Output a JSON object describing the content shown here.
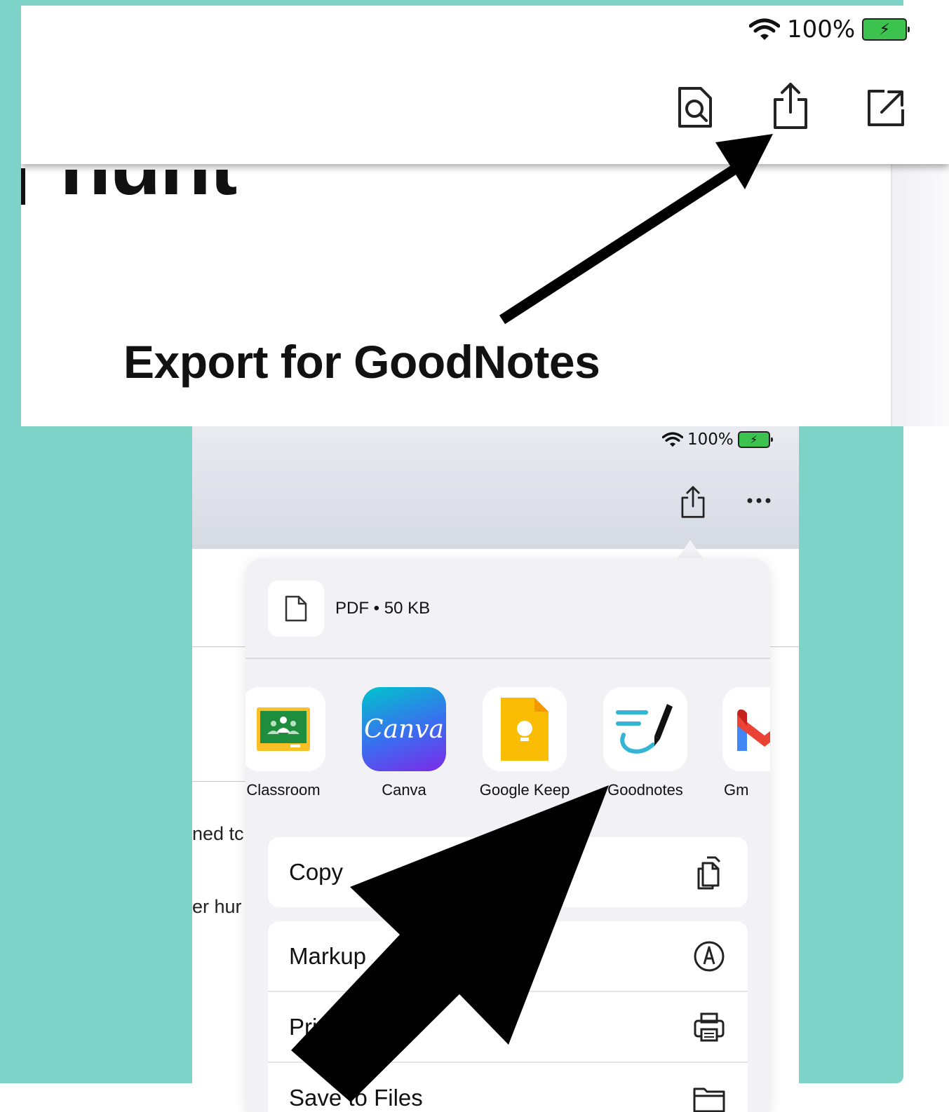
{
  "top_panel": {
    "status": {
      "battery_percent": "100%"
    },
    "title_fragment": "nunt",
    "caption": "Export for GoodNotes",
    "toolbar_icons": [
      "search-document-icon",
      "share-icon",
      "open-external-icon"
    ]
  },
  "share_sheet": {
    "status": {
      "battery_percent": "100%"
    },
    "file_info": "PDF • 50 KB",
    "background_text": [
      "ned tc",
      "er hur"
    ],
    "apps": [
      {
        "label": "Classroom"
      },
      {
        "label": "Canva",
        "logo_text": "Canva"
      },
      {
        "label": "Google Keep"
      },
      {
        "label": "Goodnotes"
      },
      {
        "label": "Gm"
      }
    ],
    "actions": [
      {
        "label": "Copy",
        "icon": "copy-icon"
      },
      {
        "label": "Markup",
        "icon": "markup-icon"
      },
      {
        "label": "Print",
        "icon": "print-icon"
      },
      {
        "label": "Save to Files",
        "icon": "folder-icon"
      }
    ]
  },
  "colors": {
    "teal_background": "#7dd3c7",
    "battery_green": "#3cc24f",
    "canva_gradient_start": "#00c4cc",
    "canva_gradient_end": "#7d2ae8",
    "keep_yellow": "#fbbc04",
    "classroom_green": "#1e8e3e"
  }
}
